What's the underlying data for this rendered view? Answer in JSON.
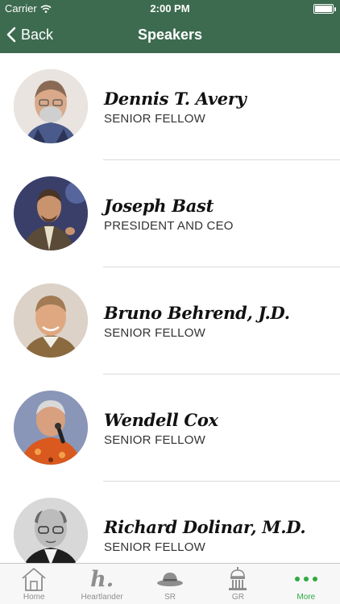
{
  "status_bar": {
    "carrier": "Carrier",
    "time": "2:00 PM"
  },
  "nav": {
    "back_label": "Back",
    "title": "Speakers"
  },
  "speakers": [
    {
      "name": "Dennis T. Avery",
      "title": "SENIOR FELLOW"
    },
    {
      "name": "Joseph Bast",
      "title": "PRESIDENT AND CEO"
    },
    {
      "name": "Bruno Behrend, J.D.",
      "title": "SENIOR FELLOW"
    },
    {
      "name": "Wendell Cox",
      "title": "SENIOR FELLOW"
    },
    {
      "name": "Richard Dolinar, M.D.",
      "title": "SENIOR FELLOW"
    }
  ],
  "tabs": [
    {
      "label": "Home",
      "icon": "house-icon"
    },
    {
      "label": "Heartlander",
      "icon": "heartlander-h-icon",
      "glyph": "h."
    },
    {
      "label": "SR",
      "icon": "hat-icon"
    },
    {
      "label": "GR",
      "icon": "capitol-icon"
    },
    {
      "label": "More",
      "icon": "more-dots-icon",
      "active": true
    }
  ],
  "colors": {
    "nav_background": "#3d6b4f",
    "tab_active": "#2eaa3f",
    "tab_inactive": "#8e8e8e"
  }
}
